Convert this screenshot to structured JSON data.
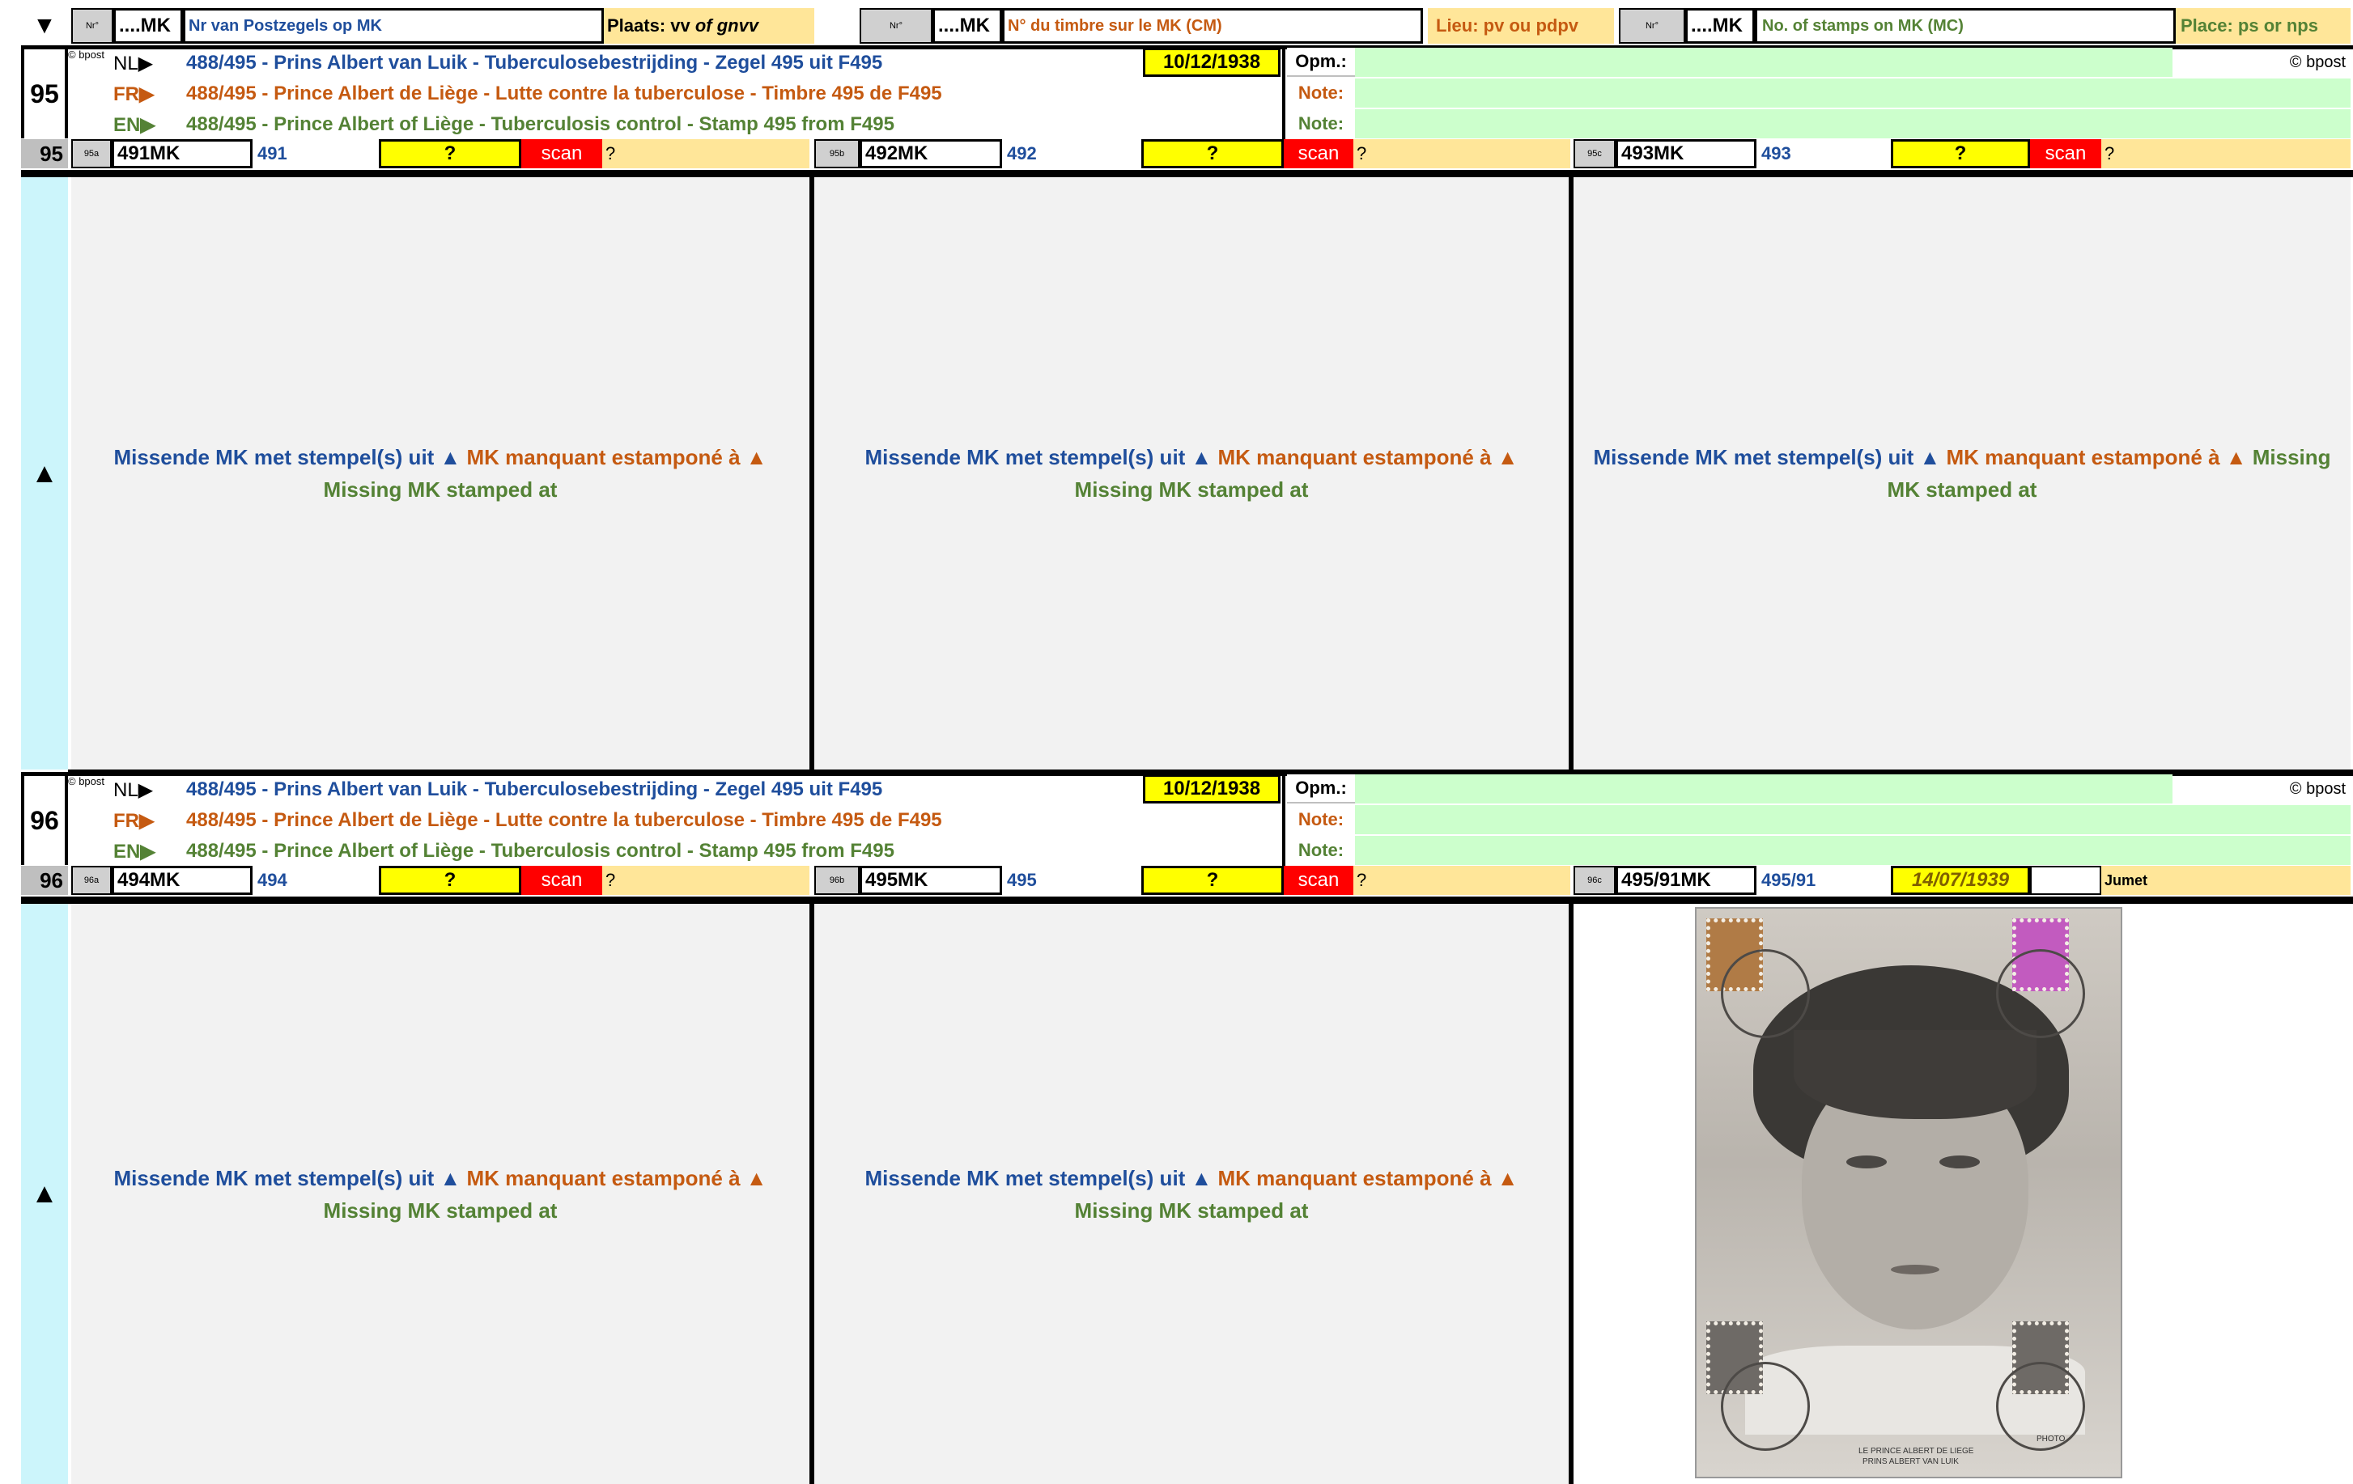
{
  "header": {
    "arrow": "▼",
    "groups": [
      {
        "nr": "Nr°",
        "mk": "....MK",
        "desc": "Nr van Postzegels op MK",
        "place": "Plaats: vv of gnvv"
      },
      {
        "nr": "Nr°",
        "mk": "....MK",
        "desc": "N° du timbre sur le MK (CM)",
        "place": "Lieu: pv ou pdpv"
      },
      {
        "nr": "Nr°",
        "mk": "....MK",
        "desc": "No. of stamps on MK (MC)",
        "place": "Place: ps or nps"
      }
    ],
    "place_nl_prefix": "Plaats: vv ",
    "place_nl_italic": "of gnvv"
  },
  "sections": [
    {
      "number": "95",
      "bpost_small": "© bpost",
      "bpost_right": "© bpost",
      "lines": [
        {
          "lang": "NL▶",
          "text": "488/495 - Prins Albert van Luik - Tuberculosebestrijding  - Zegel 495 uit F495"
        },
        {
          "lang": "FR▶",
          "text": "488/495 - Prince Albert de Liège - Lutte contre la tuberculose  - Timbre 495 de F495"
        },
        {
          "lang": "EN▶",
          "text": "488/495 - Prince Albert of Liège - Tuberculosis control  - Stamp 495 from F495"
        }
      ],
      "date": "10/12/1938",
      "notes": [
        "Opm.:",
        "Note:",
        "Note:"
      ],
      "row_number": "95",
      "items": [
        {
          "tag": "95a",
          "mk": "491MK",
          "num": "491",
          "date": "?",
          "scan": "scan",
          "place": "?"
        },
        {
          "tag": "95b",
          "mk": "492MK",
          "num": "492",
          "date": "?",
          "scan": "scan",
          "place": "?"
        },
        {
          "tag": "95c",
          "mk": "493MK",
          "num": "493",
          "date": "?",
          "scan": "scan",
          "place": "?"
        }
      ],
      "side_arrow": "▲",
      "missing": {
        "nl": "Missende MK met stempel(s) uit ▲ ",
        "fr": "MK manquant estamponé à ▲ ",
        "en": "Missing MK stamped at"
      }
    },
    {
      "number": "96",
      "bpost_small": "© bpost",
      "bpost_right": "© bpost",
      "lines": [
        {
          "lang": "NL▶",
          "text": "488/495 - Prins Albert van Luik - Tuberculosebestrijding  - Zegel 495 uit F495"
        },
        {
          "lang": "FR▶",
          "text": "488/495 - Prince Albert de Liège - Lutte contre la tuberculose  - Timbre 495 de F495"
        },
        {
          "lang": "EN▶",
          "text": "488/495 - Prince Albert of Liège - Tuberculosis control  - Stamp 495 from F495"
        }
      ],
      "date": "10/12/1938",
      "notes": [
        "Opm.:",
        "Note:",
        "Note:"
      ],
      "row_number": "96",
      "items": [
        {
          "tag": "96a",
          "mk": "494MK",
          "num": "494",
          "date": "?",
          "scan": "scan",
          "place": "?"
        },
        {
          "tag": "96b",
          "mk": "495MK",
          "num": "495",
          "date": "?",
          "scan": "scan",
          "place": "?"
        },
        {
          "tag": "96c",
          "mk": "495/91MK",
          "num": "495/91",
          "date": "14/07/1939",
          "scan": "",
          "place": "Jumet"
        }
      ],
      "side_arrow": "▲",
      "missing": {
        "nl": "Missende MK met stempel(s) uit ▲ ",
        "fr": "MK manquant estamponé à ▲ ",
        "en": "Missing MK stamped at"
      },
      "postcard_caption": [
        "LE PRINCE ALBERT DE LIÈGE",
        "PRINS ALBERT VAN LUIK"
      ],
      "postcard_photo": "PHOTO"
    }
  ],
  "colors": {
    "blue": "#1f4e9c",
    "orange": "#c55a11",
    "green": "#548235",
    "yellow": "#ffff00",
    "red": "#ff0000",
    "lightgreen": "#ccffcc",
    "cyan": "#ccf5fb"
  }
}
